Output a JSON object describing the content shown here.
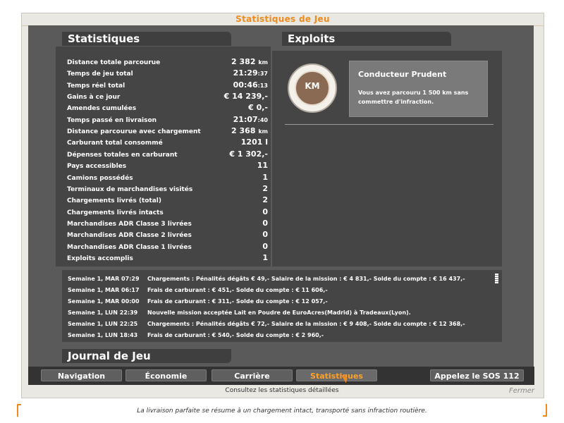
{
  "window": {
    "title": "Statistiques de Jeu",
    "close_label": "Fermer"
  },
  "stats": {
    "title": "Statistiques",
    "rows": [
      {
        "label": "Distance totale parcourue",
        "value": "2 382",
        "unit": "km"
      },
      {
        "label": "Temps de jeu total",
        "value": "21:29",
        "unit": ":37"
      },
      {
        "label": "Temps réel total",
        "value": "00:46",
        "unit": ":13"
      },
      {
        "label": "Gains à ce jour",
        "value": "€ 14 239,-",
        "unit": ""
      },
      {
        "label": "Amendes cumulées",
        "value": "€ 0,-",
        "unit": ""
      },
      {
        "label": "Temps passé en livraison",
        "value": "21:07",
        "unit": ":40"
      },
      {
        "label": "Distance parcourue avec chargement",
        "value": "2 368",
        "unit": "km"
      },
      {
        "label": "Carburant total consommé",
        "value": "1201 l",
        "unit": ""
      },
      {
        "label": "Dépenses totales en carburant",
        "value": "€ 1 302,-",
        "unit": ""
      },
      {
        "label": "Pays accessibles",
        "value": "11",
        "unit": ""
      },
      {
        "label": "Camions possédés",
        "value": "1",
        "unit": ""
      },
      {
        "label": "Terminaux de marchandises visités",
        "value": "2",
        "unit": ""
      },
      {
        "label": "Chargements livrés (total)",
        "value": "2",
        "unit": ""
      },
      {
        "label": "Chargements livrés intacts",
        "value": "0",
        "unit": ""
      },
      {
        "label": "Marchandises ADR Classe 3 livrées",
        "value": "0",
        "unit": ""
      },
      {
        "label": "Marchandises ADR Classe 2 livrées",
        "value": "0",
        "unit": ""
      },
      {
        "label": "Marchandises ADR Classe 1 livrées",
        "value": "0",
        "unit": ""
      },
      {
        "label": "Exploits accomplis",
        "value": "1",
        "unit": ""
      }
    ]
  },
  "achievements": {
    "title": "Exploits",
    "badge_text": "KM",
    "items": [
      {
        "name": "Conducteur Prudent",
        "description": "Vous avez parcouru 1 500 km sans commettre d'infraction."
      }
    ]
  },
  "journal": {
    "title": "Journal de Jeu",
    "entries": [
      {
        "date": "Semaine 1, MAR 07:29",
        "message": "Chargements : Pénalités dégâts € 49,- Salaire de la mission : € 4 831,- Solde du compte : € 16 437,-"
      },
      {
        "date": "Semaine 1, MAR 06:17",
        "message": "Frais de carburant : € 451,- Solde du compte : € 11 606,-"
      },
      {
        "date": "Semaine 1, MAR 00:00",
        "message": "Frais de carburant : € 311,- Solde du compte : € 12 057,-"
      },
      {
        "date": "Semaine 1, LUN 22:39",
        "message": "Nouvelle mission acceptée Lait en Poudre de EuroAcres(Madrid) à Tradeaux(Lyon)."
      },
      {
        "date": "Semaine 1, LUN 22:25",
        "message": "Chargements : Pénalités dégâts € 72,- Salaire de la mission : € 9 408,- Solde du compte : € 12 368,-"
      },
      {
        "date": "Semaine 1, LUN 18:43",
        "message": "Frais de carburant : € 540,- Solde du compte : € 2 960,-"
      }
    ]
  },
  "nav": {
    "buttons": [
      {
        "label": "Navigation",
        "active": false
      },
      {
        "label": "Économie",
        "active": false
      },
      {
        "label": "Carrière",
        "active": false
      },
      {
        "label": "Statistiques",
        "active": true
      }
    ],
    "sos_label": "Appelez le SOS 112",
    "hint": "Consultez les statistiques détaillées"
  },
  "tip": "La livraison parfaite se résume à un chargement intact, transporté sans infraction routière.",
  "colors": {
    "accent": "#f08a1c",
    "panel": "#454545",
    "frame": "#5a5a5a"
  }
}
